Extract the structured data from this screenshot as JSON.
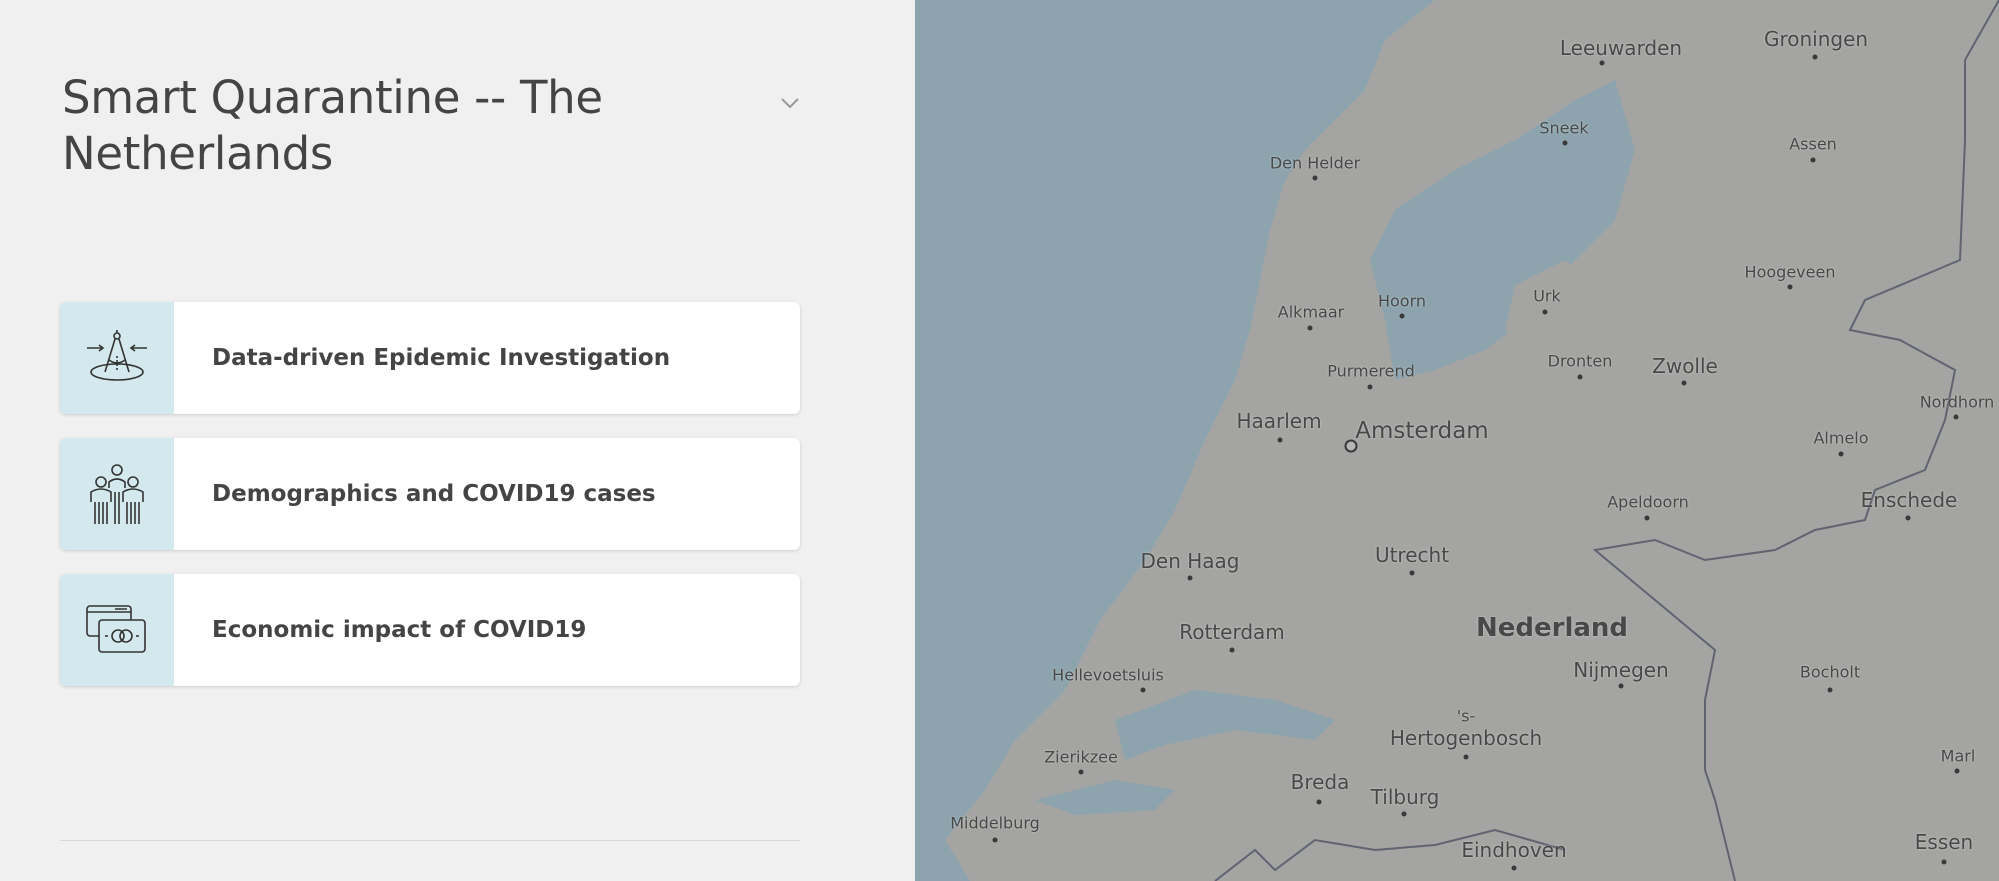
{
  "panel": {
    "title": "Smart Quarantine -- The Netherlands",
    "collapse_icon": "chevron-down-icon",
    "cards": [
      {
        "label": "Data-driven Epidemic Investigation",
        "icon": "compass-investigation-icon"
      },
      {
        "label": "Demographics and COVID19 cases",
        "icon": "people-demographics-icon"
      },
      {
        "label": "Economic impact of COVID19",
        "icon": "money-bills-icon"
      }
    ]
  },
  "map": {
    "country_label": "Nederland",
    "cities": {
      "leeuwarden": "Leeuwarden",
      "groningen": "Groningen",
      "sneek": "Sneek",
      "assen": "Assen",
      "den_helder": "Den Helder",
      "hoogeveen": "Hoogeveen",
      "alkmaar": "Alkmaar",
      "hoorn": "Hoorn",
      "urk": "Urk",
      "purmerend": "Purmerend",
      "dronten": "Dronten",
      "zwolle": "Zwolle",
      "nordhorn": "Nordhorn",
      "haarlem": "Haarlem",
      "amsterdam": "Amsterdam",
      "almelo": "Almelo",
      "apeldoorn": "Apeldoorn",
      "enschede": "Enschede",
      "den_haag": "Den Haag",
      "utrecht": "Utrecht",
      "rotterdam": "Rotterdam",
      "hellevoetsluis": "Hellevoetsluis",
      "nijmegen": "Nijmegen",
      "bocholt": "Bocholt",
      "s_prefix": "'s-",
      "hertogenbosch": "Hertogenbosch",
      "zierikzee": "Zierikzee",
      "breda": "Breda",
      "tilburg": "Tilburg",
      "marl": "Marl",
      "middelburg": "Middelburg",
      "eindhoven": "Eindhoven",
      "essen": "Essen"
    }
  }
}
